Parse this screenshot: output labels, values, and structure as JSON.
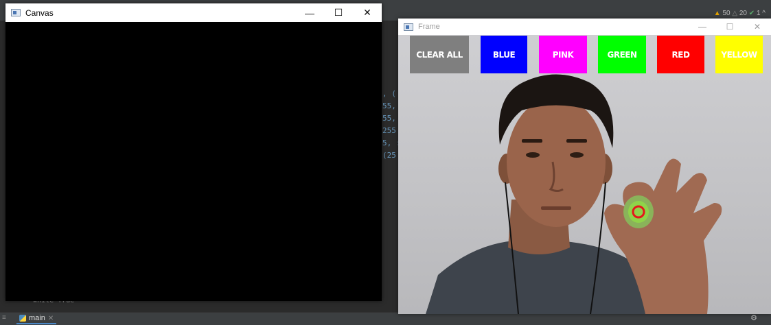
{
  "ide": {
    "inspections": {
      "warnings": "50",
      "weak_warnings": "20",
      "ok": "1"
    },
    "code_fragments": [
      ", (",
      "55,",
      "55,",
      "255",
      "5, :",
      "(25"
    ],
    "bottom_code": "while True",
    "run_tab_label": "main"
  },
  "canvas_window": {
    "title": "Canvas",
    "controls": {
      "minimize": "—",
      "maximize": "☐",
      "close": "✕"
    }
  },
  "frame_window": {
    "title": "Frame",
    "controls": {
      "minimize": "—",
      "maximize": "☐",
      "close": "✕"
    },
    "buttons": [
      {
        "label": "CLEAR ALL",
        "color": "#7f7f7f"
      },
      {
        "label": "BLUE",
        "color": "#0000ff"
      },
      {
        "label": "PINK",
        "color": "#ff00ff"
      },
      {
        "label": "GREEN",
        "color": "#00ff00"
      },
      {
        "label": "RED",
        "color": "#ff0000"
      },
      {
        "label": "YELLOW",
        "color": "#ffff00"
      }
    ],
    "tracker_color": "#e4161b"
  }
}
